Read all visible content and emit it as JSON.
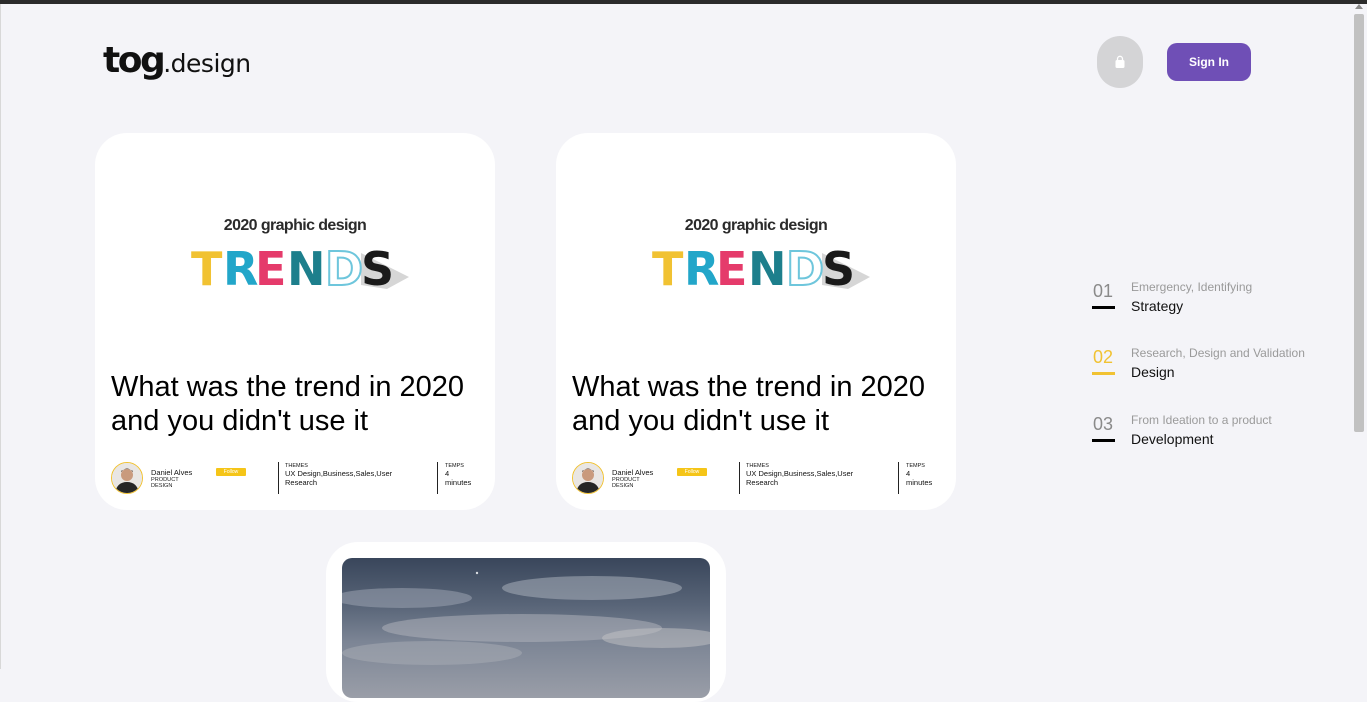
{
  "header": {
    "logo_main": "tog",
    "logo_sub": ".design",
    "cart_icon": "shopping-bag-icon",
    "signin_label": "Sign In"
  },
  "colors": {
    "accent_purple": "#6f4fb6",
    "accent_yellow": "#f1c232",
    "background": "#f4f4f8"
  },
  "cards": [
    {
      "image_caption": "2020 graphic design",
      "image_word": "TRENDS",
      "title": "What was the trend in 2020 and you didn't use it",
      "author": "Daniel Alves",
      "role": "Product Design",
      "follow_label": "Follow",
      "themes_label": "Themes",
      "themes": "UX Design,Business,Sales,User Research",
      "temps_label": "Temps",
      "temps": "4 minutes"
    },
    {
      "image_caption": "2020 graphic design",
      "image_word": "TRENDS",
      "title": "What was the trend in 2020 and you didn't use it",
      "author": "Daniel Alves",
      "role": "Product Design",
      "follow_label": "Follow",
      "themes_label": "Themes",
      "themes": "UX Design,Business,Sales,User Research",
      "temps_label": "Temps",
      "temps": "4 minutes"
    }
  ],
  "steps": [
    {
      "num": "01",
      "subtitle": "Emergency, Identifying",
      "title": "Strategy",
      "active": false
    },
    {
      "num": "02",
      "subtitle": "Research, Design and Validation",
      "title": "Design",
      "active": true
    },
    {
      "num": "03",
      "subtitle": "From Ideation to a product",
      "title": "Development",
      "active": false
    }
  ]
}
